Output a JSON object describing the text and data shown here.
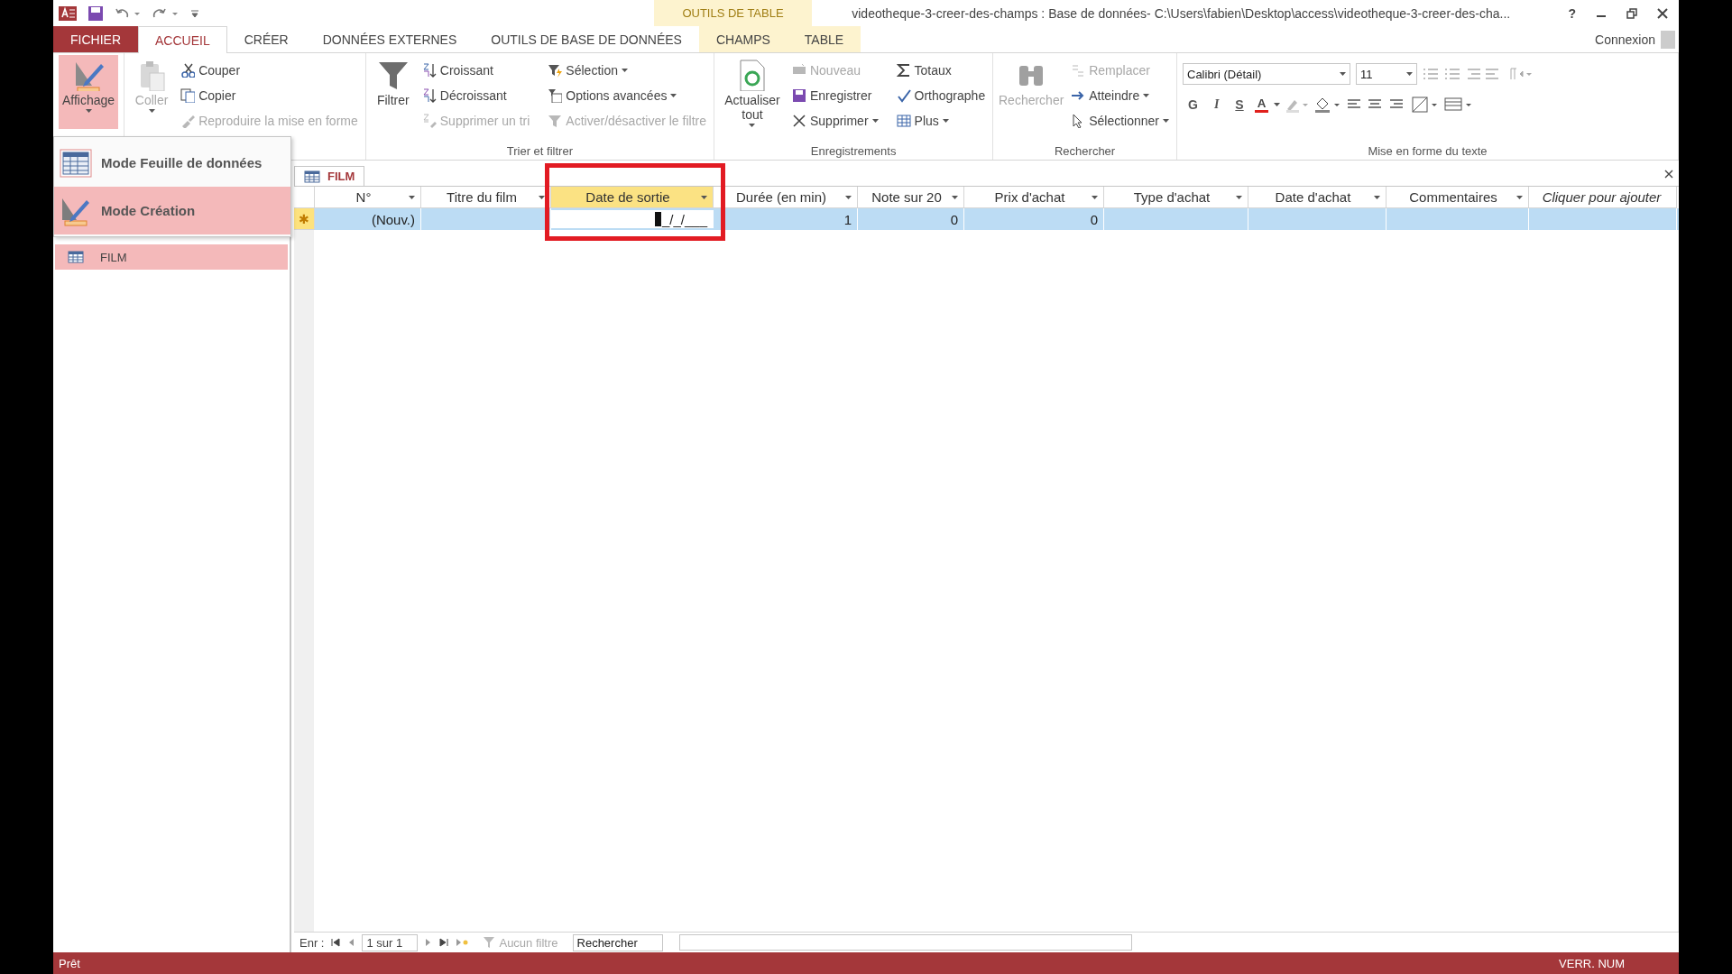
{
  "title_bar": {
    "context_group": "OUTILS DE TABLE",
    "title": "videotheque-3-creer-des-champs : Base de données- C:\\Users\\fabien\\Desktop\\access\\videotheque-3-creer-des-cha...",
    "help": "?"
  },
  "tabs": [
    {
      "label": "FICHIER",
      "kind": "file",
      "selected": false
    },
    {
      "label": "ACCUEIL",
      "kind": "normal",
      "selected": true
    },
    {
      "label": "CRÉER",
      "kind": "normal",
      "selected": false
    },
    {
      "label": "DONNÉES EXTERNES",
      "kind": "normal",
      "selected": false
    },
    {
      "label": "OUTILS DE BASE DE DONNÉES",
      "kind": "normal",
      "selected": false
    },
    {
      "label": "CHAMPS",
      "kind": "contextual",
      "selected": false
    },
    {
      "label": "TABLE",
      "kind": "contextual",
      "selected": false
    }
  ],
  "account": "Connexion",
  "ribbon": {
    "groups": [
      {
        "items": [
          {
            "label": "Affichage",
            "kind": "large",
            "dropdown": true,
            "active": true,
            "disabled": false
          }
        ]
      },
      {
        "items": [
          {
            "label": "Coller",
            "kind": "large",
            "dropdown": true,
            "active": false,
            "disabled": true
          },
          {
            "label": "Couper",
            "kind": "small",
            "dropdown": false,
            "active": false,
            "disabled": false
          },
          {
            "label": "Copier",
            "kind": "small",
            "dropdown": false,
            "active": false,
            "disabled": false
          },
          {
            "label": "Reproduire la mise en forme",
            "kind": "small",
            "dropdown": false,
            "active": false,
            "disabled": true
          }
        ]
      },
      {
        "label": "Trier et filtrer",
        "items": [
          {
            "label": "Filtrer",
            "kind": "large",
            "dropdown": false,
            "active": false,
            "disabled": false
          },
          {
            "label": "Croissant",
            "kind": "small",
            "dropdown": false,
            "active": false,
            "disabled": false
          },
          {
            "label": "Décroissant",
            "kind": "small",
            "dropdown": false,
            "active": false,
            "disabled": false
          },
          {
            "label": "Supprimer un tri",
            "kind": "small",
            "dropdown": false,
            "active": false,
            "disabled": true
          },
          {
            "label": "Sélection",
            "kind": "small",
            "dropdown": true,
            "active": false,
            "disabled": false
          },
          {
            "label": "Options avancées",
            "kind": "small",
            "dropdown": true,
            "active": false,
            "disabled": false
          },
          {
            "label": "Activer/désactiver le filtre",
            "kind": "small",
            "dropdown": false,
            "active": false,
            "disabled": true
          }
        ]
      },
      {
        "label": "Enregistrements",
        "items": [
          {
            "label": "Actualiser tout",
            "kind": "large",
            "dropdown": true,
            "active": false,
            "disabled": false
          },
          {
            "label": "Nouveau",
            "kind": "small",
            "dropdown": false,
            "active": false,
            "disabled": true
          },
          {
            "label": "Enregistrer",
            "kind": "small",
            "dropdown": false,
            "active": false,
            "disabled": false
          },
          {
            "label": "Supprimer",
            "kind": "small",
            "dropdown": true,
            "active": false,
            "disabled": false
          },
          {
            "label": "Totaux",
            "kind": "small",
            "dropdown": false,
            "active": false,
            "disabled": false
          },
          {
            "label": "Orthographe",
            "kind": "small",
            "dropdown": false,
            "active": false,
            "disabled": false
          },
          {
            "label": "Plus",
            "kind": "small",
            "dropdown": true,
            "active": false,
            "disabled": false
          }
        ]
      },
      {
        "label": "Rechercher",
        "items": [
          {
            "label": "Rechercher",
            "kind": "large",
            "dropdown": false,
            "active": false,
            "disabled": true
          },
          {
            "label": "Remplacer",
            "kind": "small",
            "dropdown": false,
            "active": false,
            "disabled": true
          },
          {
            "label": "Atteindre",
            "kind": "small",
            "dropdown": true,
            "active": false,
            "disabled": false
          },
          {
            "label": "Sélectionner",
            "kind": "small",
            "dropdown": true,
            "active": false,
            "disabled": false
          }
        ]
      }
    ],
    "font_group": {
      "label": "Mise en forme du texte",
      "font": "Calibri (Détail)",
      "size": "11",
      "styles": [
        "G",
        "I",
        "S"
      ],
      "font_color": "A"
    }
  },
  "view_menu": [
    {
      "label": "Mode Feuille de données",
      "selected": false
    },
    {
      "label": "Mode Création",
      "selected": true
    }
  ],
  "nav_pane": {
    "items": [
      {
        "label": "FILM",
        "selected": true
      }
    ]
  },
  "document_tab": "FILM",
  "table": {
    "columns": [
      {
        "label": "N°",
        "kind": "field",
        "selected": false,
        "outlined": false
      },
      {
        "label": "Titre du film",
        "kind": "field",
        "selected": false,
        "outlined": false
      },
      {
        "label": "Date de sortie",
        "kind": "field",
        "selected": true,
        "outlined": true
      },
      {
        "label": "Durée (en min)",
        "kind": "field",
        "selected": false,
        "outlined": false
      },
      {
        "label": "Note sur 20",
        "kind": "field",
        "selected": false,
        "outlined": false
      },
      {
        "label": "Prix d'achat",
        "kind": "field",
        "selected": false,
        "outlined": false
      },
      {
        "label": "Type d'achat",
        "kind": "field",
        "selected": false,
        "outlined": false
      },
      {
        "label": "Date d'achat",
        "kind": "field",
        "selected": false,
        "outlined": false
      },
      {
        "label": "Commentaires",
        "kind": "field",
        "selected": false,
        "outlined": false
      },
      {
        "label": "Cliquer pour ajouter",
        "kind": "add",
        "selected": false,
        "outlined": false
      }
    ],
    "new_row": {
      "marker": "✱",
      "cells": [
        {
          "value": "(Nouv.)",
          "cursor": false
        },
        null,
        {
          "value": "_/_/___",
          "cursor": true
        },
        {
          "value": "1",
          "cursor": false
        },
        {
          "value": "0",
          "cursor": false
        },
        {
          "value": "0",
          "cursor": false
        },
        null,
        null,
        null,
        null
      ]
    }
  },
  "record_nav": {
    "label": "Enr :",
    "position": "1 sur 1",
    "filter": "Aucun filtre",
    "search_placeholder": "Rechercher"
  },
  "status_bar": {
    "left": "Prêt",
    "right": "VERR. NUM"
  }
}
